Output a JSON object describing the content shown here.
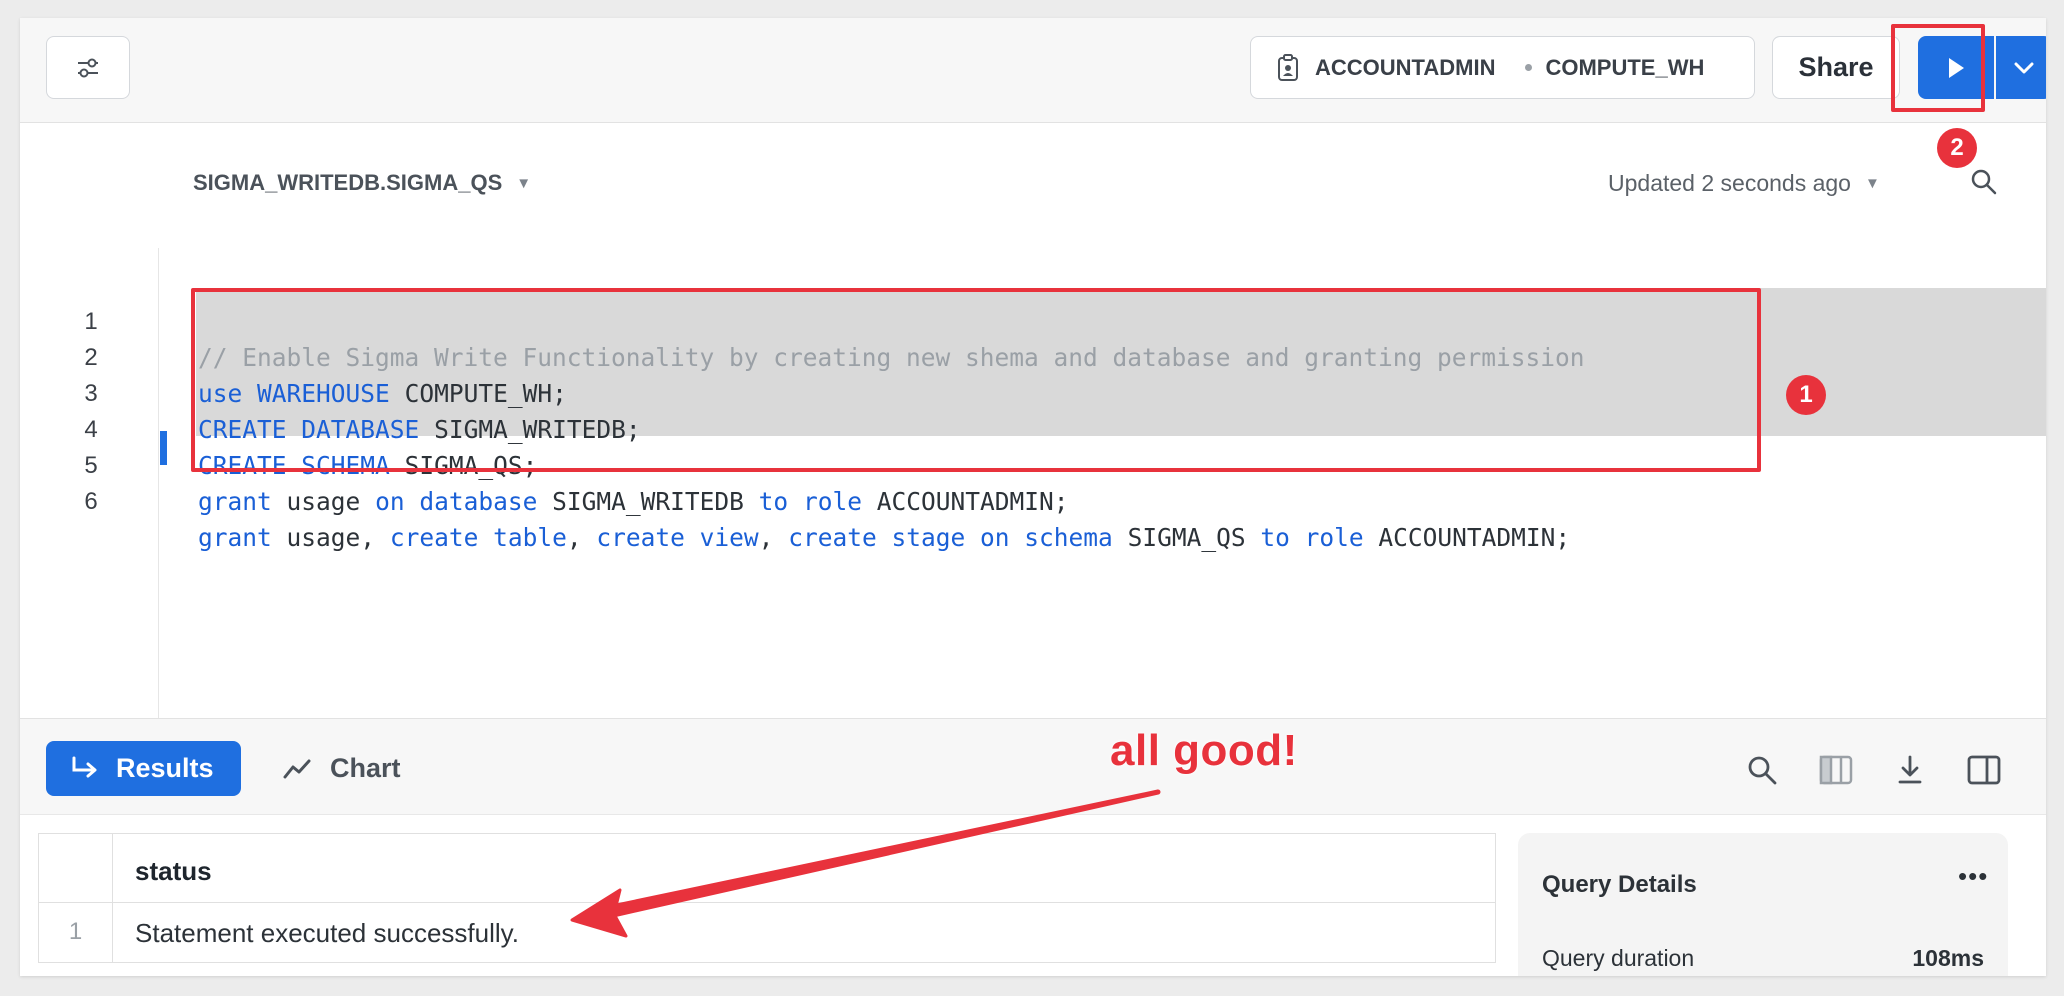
{
  "toolbar": {
    "filter_icon": "sliders-icon",
    "role": "ACCOUNTADMIN",
    "warehouse": "COMPUTE_WH",
    "share_label": "Share",
    "run_icon": "play-icon",
    "run_dropdown_icon": "chevron-down-icon"
  },
  "editor": {
    "db_schema": "SIGMA_WRITEDB.SIGMA_QS",
    "updated_text": "Updated 2 seconds ago",
    "lines": [
      {
        "num": "1"
      },
      {
        "num": "2"
      },
      {
        "num": "3"
      },
      {
        "num": "4"
      },
      {
        "num": "5"
      },
      {
        "num": "6"
      }
    ],
    "code": {
      "l1": "// Enable Sigma Write Functionality by creating new shema and database and granting permission",
      "l2a": "use",
      "l2b": "WAREHOUSE",
      "l2c": "COMPUTE_WH;",
      "l3a": "CREATE",
      "l3b": "DATABASE",
      "l3c": "SIGMA_WRITEDB;",
      "l4a": "CREATE",
      "l4b": "SCHEMA",
      "l4c": "SIGMA_QS;",
      "l5a": "grant",
      "l5b": "usage",
      "l5c": "on",
      "l5d": "database",
      "l5e": "SIGMA_WRITEDB",
      "l5f": "to",
      "l5g": "role",
      "l5h": "ACCOUNTADMIN;",
      "l6a": "grant",
      "l6b": "usage,",
      "l6c": "create",
      "l6d": "table",
      "l6e": "create",
      "l6f": "view",
      "l6g": "create",
      "l6h": "stage",
      "l6i": "on",
      "l6j": "schema",
      "l6k": "SIGMA_QS",
      "l6l": "to",
      "l6m": "role",
      "l6n": "ACCOUNTADMIN;"
    }
  },
  "annotations": {
    "badge_code": "1",
    "badge_run": "2",
    "callout": "all good!",
    "color": "#e8323c"
  },
  "results": {
    "results_tab": "Results",
    "chart_tab": "Chart",
    "table": {
      "header": "status",
      "rows": [
        {
          "num": "1",
          "status": "Statement executed successfully."
        }
      ]
    },
    "details": {
      "title": "Query Details",
      "more": "•••",
      "duration_label": "Query duration",
      "duration_value": "108ms"
    }
  },
  "colors": {
    "accent": "#1f6fe0",
    "keyword": "#1a5fd6",
    "comment": "#9aa0a6",
    "selection": "#d9d9d9"
  }
}
